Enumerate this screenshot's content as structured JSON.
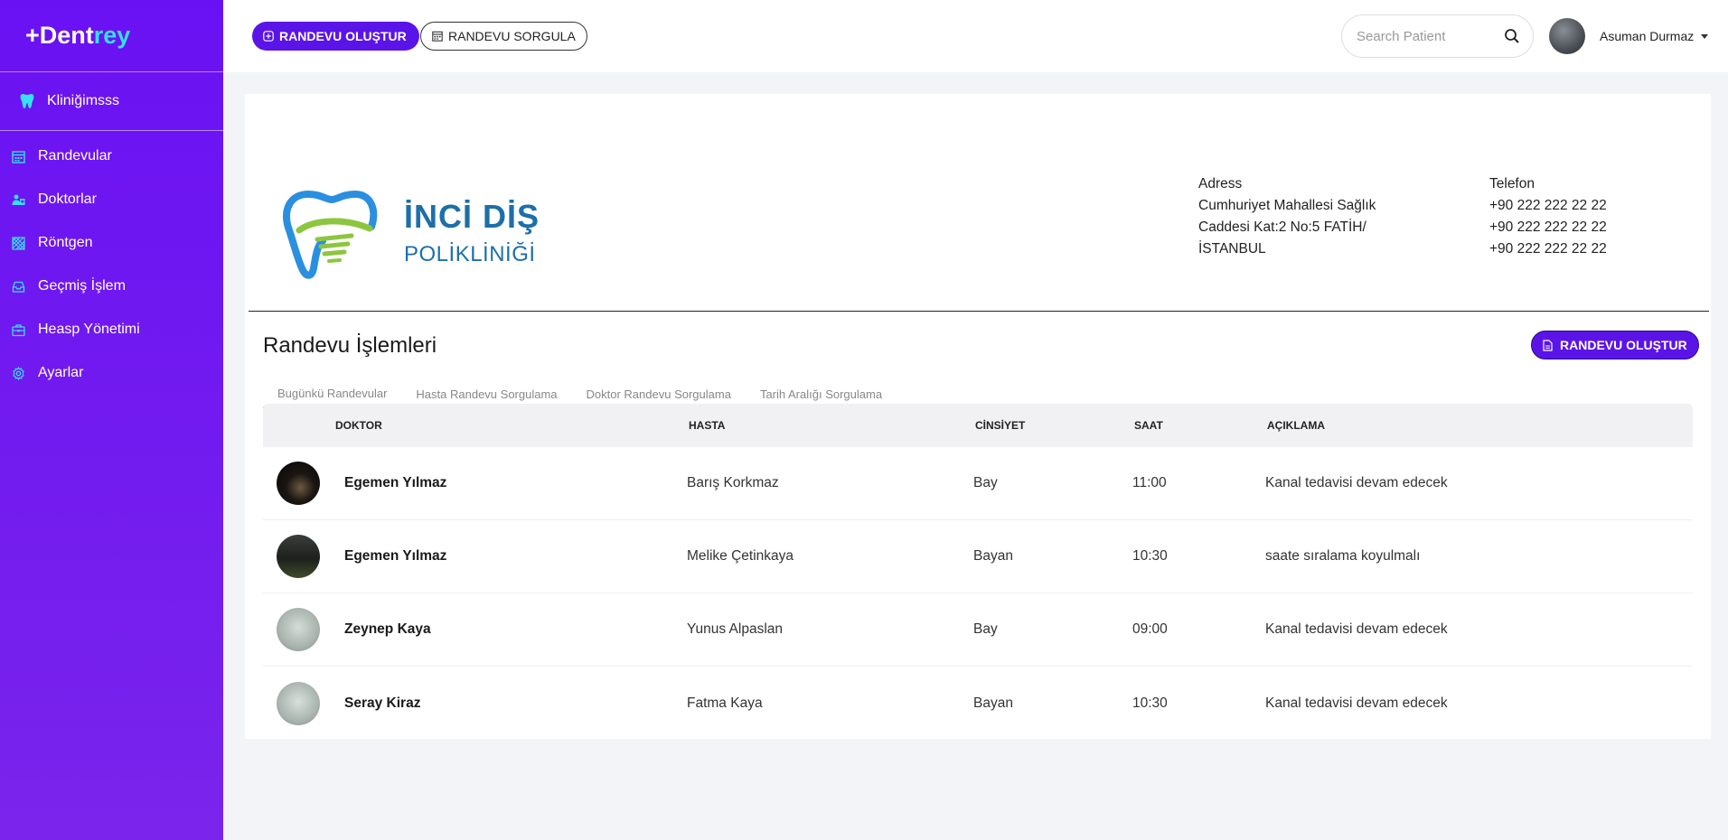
{
  "sidebar": {
    "brand_plus": "+Dent",
    "brand_accent": "rey",
    "clinic": "Kliniğimsss",
    "items": [
      {
        "label": "Randevular",
        "icon": "calendar-icon"
      },
      {
        "label": "Doktorlar",
        "icon": "doctors-icon"
      },
      {
        "label": "Röntgen",
        "icon": "xray-icon"
      },
      {
        "label": "Geçmiş İşlem",
        "icon": "inbox-icon"
      },
      {
        "label": "Heasp Yönetimi",
        "icon": "briefcase-icon"
      },
      {
        "label": "Ayarlar",
        "icon": "gear-icon"
      }
    ]
  },
  "topbar": {
    "create_label": "RANDEVU OLUŞTUR",
    "query_label": "RANDEVU SORGULA",
    "search_placeholder": "Search Patient",
    "user_name": "Asuman Durmaz"
  },
  "clinic_card": {
    "title": "İNCİ DİŞ",
    "subtitle": "POLİKLİNİĞİ",
    "address_label": "Adress",
    "address_lines": [
      "Cumhuriyet Mahallesi Sağlık",
      "Caddesi Kat:2 No:5 FATİH/",
      "İSTANBUL"
    ],
    "phone_label": "Telefon",
    "phones": [
      "+90 222 222 22 22",
      "+90 222 222 22 22",
      "+90 222 222 22 22"
    ]
  },
  "appointments": {
    "title": "Randevu İşlemleri",
    "create_label": "RANDEVU OLUŞTUR",
    "tabs": [
      "Bugünkü Randevular",
      "Hasta Randevu Sorgulama",
      "Doktor Randevu Sorgulama",
      "Tarih Aralığı Sorgulama"
    ],
    "columns": [
      "DOKTOR",
      "HASTA",
      "CİNSİYET",
      "SAAT",
      "AÇIKLAMA"
    ],
    "rows": [
      {
        "doctor": "Egemen Yılmaz",
        "patient": "Barış Korkmaz",
        "gender": "Bay",
        "time": "11:00",
        "note": "Kanal tedavisi devam edecek"
      },
      {
        "doctor": "Egemen Yılmaz",
        "patient": "Melike Çetinkaya",
        "gender": "Bayan",
        "time": "10:30",
        "note": "saate sıralama koyulmalı"
      },
      {
        "doctor": "Zeynep Kaya",
        "patient": "Yunus Alpaslan",
        "gender": "Bay",
        "time": "09:00",
        "note": "Kanal tedavisi devam edecek"
      },
      {
        "doctor": "Seray Kiraz",
        "patient": "Fatma Kaya",
        "gender": "Bayan",
        "time": "10:30",
        "note": "Kanal tedavisi devam edecek"
      }
    ]
  },
  "colors": {
    "sidebar": "#6a11f3",
    "primary_button": "#5b14e8",
    "brand_accent": "#35e0f0",
    "logo_blue": "#1d6fa8",
    "logo_green": "#8cc63f"
  }
}
